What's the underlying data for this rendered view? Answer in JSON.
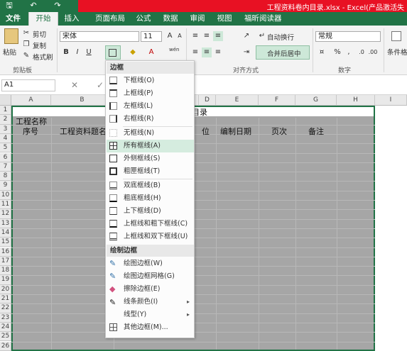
{
  "window": {
    "title": "工程资料卷内目录.xlsx - Excel(产品激活失"
  },
  "quick_access": {
    "save": "🖫",
    "undo": "↶",
    "redo": "↷"
  },
  "tabs": [
    "文件",
    "开始",
    "插入",
    "页面布局",
    "公式",
    "数据",
    "审阅",
    "视图",
    "福昕阅读器"
  ],
  "clipboard": {
    "paste": "粘贴",
    "cut": "剪切",
    "copy": "复制",
    "format_painter": "格式刷",
    "group": "剪贴板"
  },
  "font": {
    "name": "宋体",
    "size": "11",
    "bold": "B",
    "italic": "I",
    "underline": "U",
    "font_color_glyph": "A",
    "phonetic": "wén"
  },
  "alignment": {
    "wrap": "自动换行",
    "merge": "合并后居中",
    "group": "对齐方式"
  },
  "number": {
    "format": "常规",
    "percent": "%",
    "comma": ",",
    "group": "数字"
  },
  "styles": {
    "conditional": "条件格"
  },
  "formula_bar": {
    "name_box": "A1",
    "cancel": "✕",
    "fx_partial": "f"
  },
  "columns": [
    "A",
    "B",
    "C",
    "D",
    "E",
    "F",
    "G",
    "H",
    "I"
  ],
  "rows": [
    "1",
    "2",
    "3",
    "4",
    "5",
    "6",
    "7",
    "8",
    "9",
    "10",
    "11",
    "12",
    "13",
    "14",
    "15",
    "16",
    "17",
    "18",
    "19",
    "20",
    "21",
    "22",
    "23",
    "24",
    "25",
    "26"
  ],
  "cells": {
    "title": "目录",
    "b2": "工程名称",
    "seq": "序号",
    "doc_title": "工程资料题名",
    "unit_partial": "位",
    "date": "编制日期",
    "pages": "页次",
    "remarks": "备注"
  },
  "menu": {
    "header_borders": "边框",
    "items": [
      "下框线(O)",
      "上框线(P)",
      "左框线(L)",
      "右框线(R)",
      "无框线(N)",
      "所有框线(A)",
      "外侧框线(S)",
      "粗匣框线(T)",
      "双底框线(B)",
      "粗底框线(H)",
      "上下框线(D)",
      "上框线和粗下框线(C)",
      "上框线和双下框线(U)"
    ],
    "header_draw": "绘制边框",
    "draw_items": [
      "绘图边框(W)",
      "绘图边框网格(G)",
      "擦除边框(E)",
      "线条颜色(I)",
      "线型(Y)",
      "其他边框(M)..."
    ],
    "highlighted": "所有框线(A)"
  },
  "colors": {
    "excel_green": "#217346",
    "title_red": "#e81123",
    "highlight": "#d5ecdf",
    "selection_gray": "#a6a6a6"
  }
}
